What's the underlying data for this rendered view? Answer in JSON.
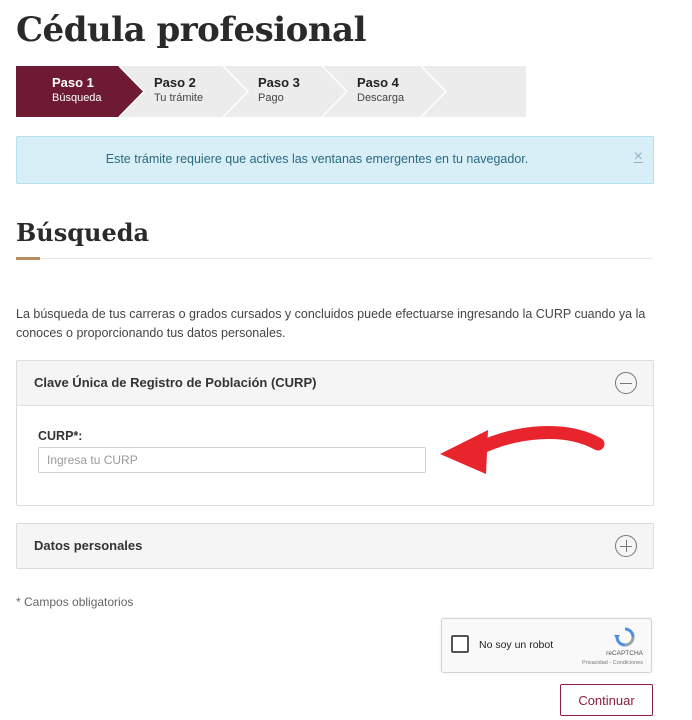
{
  "page": {
    "title": "Cédula profesional"
  },
  "stepper": {
    "steps": [
      {
        "title": "Paso 1",
        "subtitle": "Búsqueda",
        "active": true
      },
      {
        "title": "Paso 2",
        "subtitle": "Tu trámite",
        "active": false
      },
      {
        "title": "Paso 3",
        "subtitle": "Pago",
        "active": false
      },
      {
        "title": "Paso 4",
        "subtitle": "Descarga",
        "active": false
      }
    ],
    "active_color": "#6f1a33",
    "inactive_color": "#ececec"
  },
  "alert": {
    "message": "Este trámite requiere que actives las ventanas emergentes en tu navegador.",
    "close_symbol": "×"
  },
  "search": {
    "heading": "Búsqueda",
    "description": "La búsqueda de tus carreras o grados cursados y concluidos puede efectuarse ingresando la CURP cuando ya la conoces o proporcionando tus datos personales."
  },
  "curp_panel": {
    "title": "Clave Única de Registro de Población (CURP)",
    "toggle_icon": "minus-circle-icon",
    "field_label": "CURP*:",
    "field_placeholder": "Ingresa tu CURP",
    "field_value": ""
  },
  "datos_panel": {
    "title": "Datos personales",
    "toggle_icon": "plus-circle-icon"
  },
  "required_note": "* Campos obligatorios",
  "recaptcha": {
    "label": "No soy un robot",
    "brand": "reCAPTCHA",
    "terms": "Privacidad - Condiciones"
  },
  "actions": {
    "continue_label": "Continuar",
    "accent_color": "#8c1f3c"
  },
  "annotation": {
    "arrow_color": "#e8242c"
  }
}
